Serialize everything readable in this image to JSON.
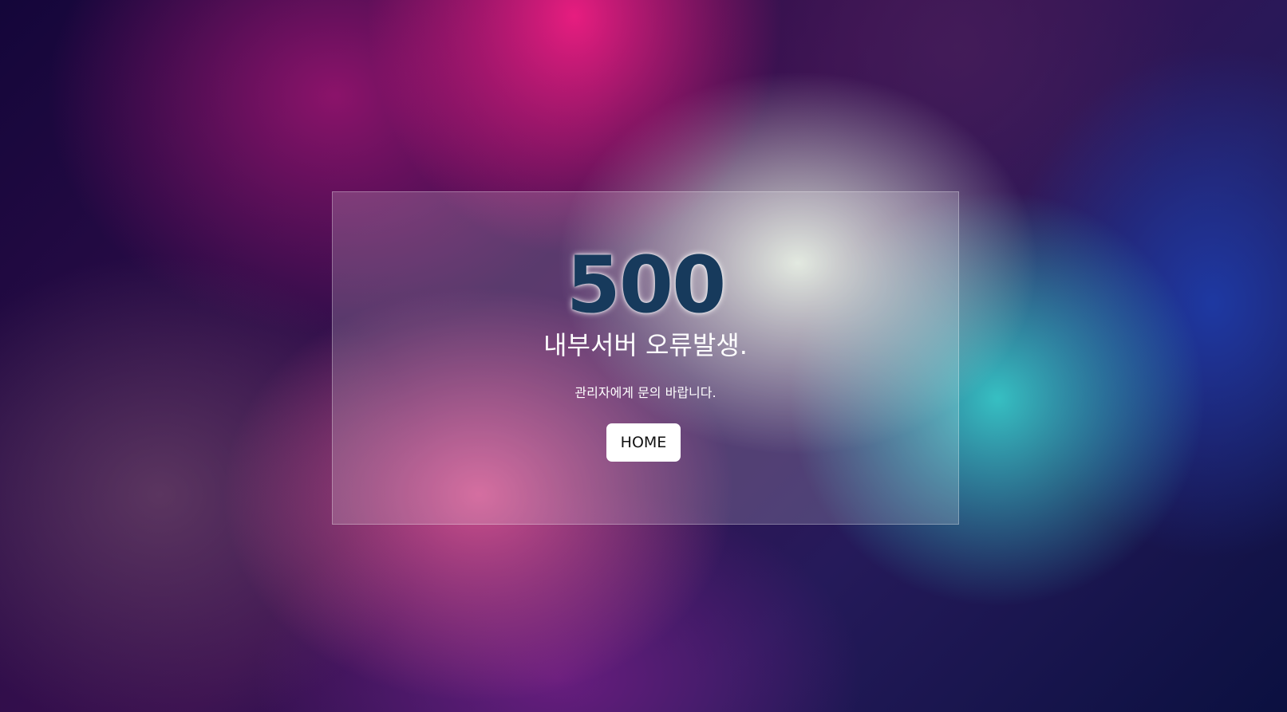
{
  "error": {
    "code": "500",
    "title": "내부서버 오류발생.",
    "message": "관리자에게 문의 바랍니다.",
    "home_label": "HOME"
  },
  "colors": {
    "code_text": "#173a5c",
    "button_bg": "#ffffff",
    "card_bg": "rgba(255,255,255,0.18)"
  }
}
